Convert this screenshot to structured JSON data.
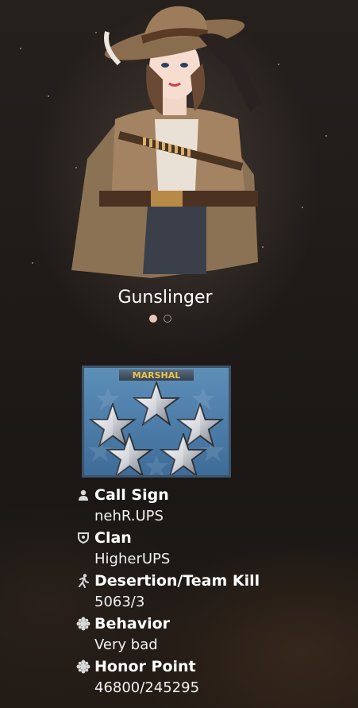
{
  "character": {
    "name": "Gunslinger",
    "carousel": {
      "pages": 2,
      "active_page": 1
    }
  },
  "rank": {
    "title": "MARSHAL",
    "stars": 5
  },
  "profile": {
    "call_sign": {
      "label": "Call Sign",
      "value": "nehR.UPS",
      "icon": "person-icon"
    },
    "clan": {
      "label": "Clan",
      "value": "HigherUPS",
      "icon": "clan-shield-icon"
    },
    "desertion": {
      "label": "Desertion/Team Kill",
      "value": "5063/3",
      "icon": "running-man-icon"
    },
    "behavior": {
      "label": "Behavior",
      "value": "Very bad",
      "icon": "gear-badge-icon"
    },
    "honor": {
      "label": "Honor Point",
      "value": "46800/245295",
      "icon": "gear-badge-icon"
    }
  }
}
